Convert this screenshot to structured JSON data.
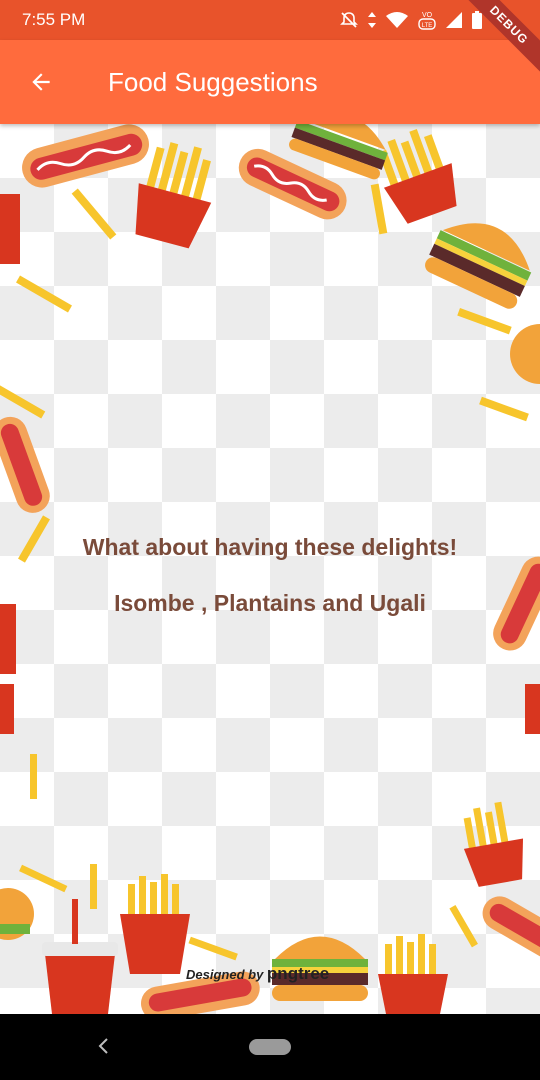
{
  "status_bar": {
    "time": "7:55 PM",
    "icons": [
      "mute-icon",
      "data-arrows-icon",
      "wifi-icon",
      "volte-icon",
      "signal-icon",
      "battery-icon"
    ],
    "debug_label": "DEBUG"
  },
  "app_bar": {
    "title": "Food Suggestions",
    "back_icon": "arrow-back-icon",
    "color": "#ff6b3d"
  },
  "content": {
    "headline": "What about having these delights!",
    "suggestion": "Isombe , Plantains and Ugali",
    "text_color": "#7a4b3a",
    "watermark_prefix": "Designed by",
    "watermark_brand": "pngtree"
  },
  "nav_bar": {
    "icons": [
      "nav-back-icon",
      "home-pill"
    ]
  }
}
